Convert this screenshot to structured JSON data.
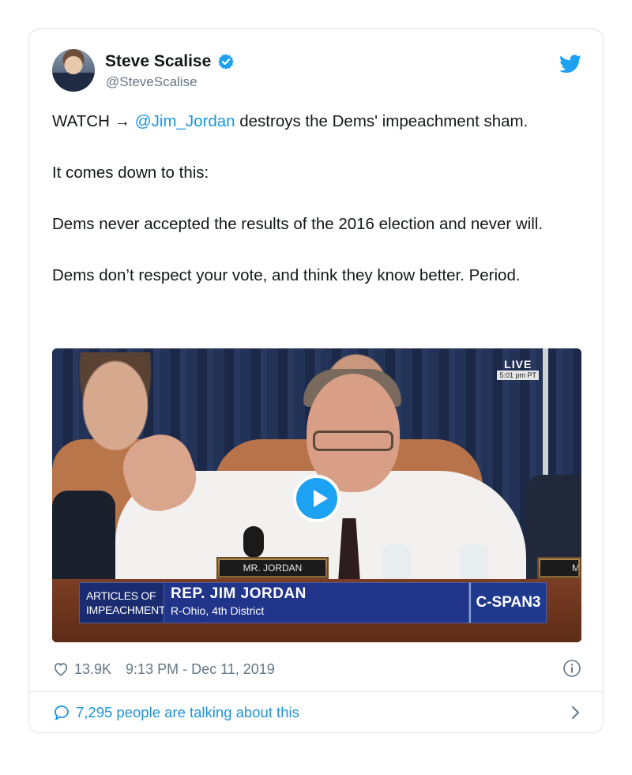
{
  "tweet": {
    "author": {
      "name": "Steve Scalise",
      "handle": "@SteveScalise"
    },
    "paragraphs": [
      {
        "before": "WATCH → ",
        "mention": "@Jim_Jordan",
        "after": " destroys the Dems' impeachment sham."
      },
      {
        "text": "It comes down to this:"
      },
      {
        "text": "Dems never accepted the results of the 2016 election and never will."
      },
      {
        "text": "Dems don’t respect your vote, and think they know better. Period."
      }
    ],
    "video": {
      "live_label": "LIVE",
      "live_time": "5:01 pm PT",
      "nameplate": "MR. JORDAN",
      "nameplate_right": "M",
      "lower_third": {
        "segment_line1": "ARTICLES OF",
        "segment_line2": "IMPEACHMENT",
        "speaker": "REP. JIM JORDAN",
        "district": "R-Ohio, 4th District",
        "network": "C-SPAN3"
      }
    },
    "likes": "13.9K",
    "timestamp": "9:13 PM - Dec 11, 2019",
    "talking": "7,295 people are talking about this",
    "colors": {
      "link": "#1b95e0",
      "muted": "#657786",
      "brand": "#1da1f2"
    },
    "icons": [
      "verified-badge-icon",
      "twitter-bird-icon",
      "play-icon",
      "heart-icon",
      "info-icon",
      "speech-bubble-icon",
      "chevron-right-icon"
    ]
  }
}
